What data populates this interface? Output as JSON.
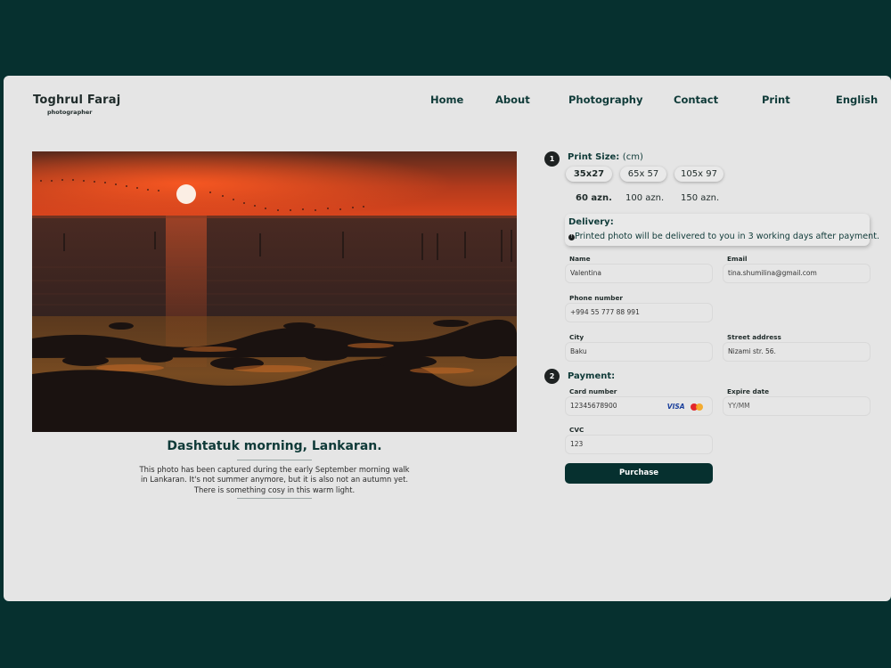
{
  "brand": {
    "name": "Toghrul Faraj",
    "subtitle": "photographer"
  },
  "nav": {
    "items": [
      "Home",
      "About",
      "Photography",
      "Contact",
      "Print",
      "English"
    ]
  },
  "photo": {
    "title": "Dashtatuk morning, Lankaran.",
    "description_lines": [
      "This photo has been captured during the early September morning walk",
      "in Lankaran.  It's not summer anymore, but it is also not an autumn yet.",
      "There is  something cosy in this warm light."
    ]
  },
  "print_size": {
    "step": "1",
    "label": "Print Size:",
    "unit": "(cm)",
    "options": [
      {
        "size": "35x27",
        "price": "60 azn.",
        "selected": true
      },
      {
        "size": "65x 57",
        "price": "100 azn.",
        "selected": false
      },
      {
        "size": "105x 97",
        "price": "150 azn.",
        "selected": false
      }
    ]
  },
  "delivery": {
    "title": "Delivery:",
    "info_glyph": "!",
    "note": "Printed photo will be delivered  to you in 3 working days after payment."
  },
  "form": {
    "name": {
      "label": "Name",
      "value": "Valentina"
    },
    "email": {
      "label": "Email",
      "value": "tina.shumilina@gmail.com"
    },
    "phone": {
      "label": "Phone number",
      "value": "+994 55 777 88 991"
    },
    "city": {
      "label": "City",
      "value": "Baku"
    },
    "street": {
      "label": "Street address",
      "value": "Nizami str. 56."
    }
  },
  "payment": {
    "step": "2",
    "title": "Payment:",
    "card_number": {
      "label": "Card number",
      "value": "12345678900",
      "brand_visa": "VISA",
      "brand_icon": "mastercard-icon"
    },
    "expire": {
      "label": "Expire date",
      "placeholder": "YY/MM"
    },
    "cvc": {
      "label": "CVC",
      "value": "123"
    },
    "purchase_label": "Purchase"
  },
  "colors": {
    "background": "#06302f",
    "card": "#e5e5e5",
    "accent": "#0f3a38",
    "sunset": "#e2431f"
  }
}
